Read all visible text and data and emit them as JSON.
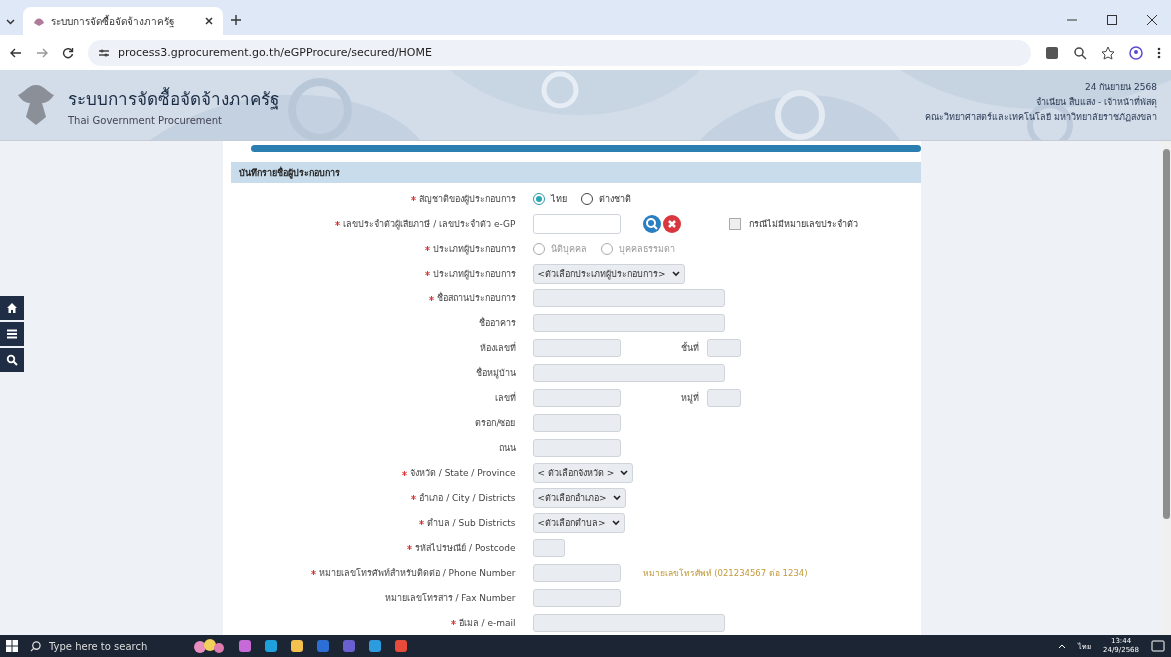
{
  "browser": {
    "tab_title": "ระบบการจัดซื้อจัดจ้างภาครัฐ",
    "url": "process3.gprocurement.go.th/eGPProcure/secured/HOME"
  },
  "header": {
    "title": "ระบบการจัดซื้อจัดจ้างภาครัฐ",
    "subtitle": "Thai Government Procurement",
    "date": "24 กันยายน 2568",
    "user": "จำเนียน สืบแสง - เจ้าหน้าที่พัสดุ",
    "organization": "คณะวิทยาศาสตร์และเทคโนโลยี มหาวิทยาลัยราชภัฏสงขลา"
  },
  "form": {
    "title": "บันทึกรายชื่อผู้ประกอบการ",
    "rows": [
      {
        "kind": "radio",
        "label": "สัญชาติของผู้ประกอบการ",
        "required": true,
        "disabled": false,
        "options": [
          {
            "label": "ไทย",
            "selected": true
          },
          {
            "label": "ต่างชาติ",
            "selected": false
          }
        ]
      },
      {
        "kind": "lookup",
        "label": "เลขประจำตัวผู้เสียภาษี / เลขประจำตัว e-GP",
        "required": true,
        "checkbox": {
          "label": "กรณีไม่มีหมายเลขประจำตัว",
          "checked": false
        }
      },
      {
        "kind": "radio",
        "label": "ประเภทผู้ประกอบการ",
        "required": true,
        "disabled": true,
        "options": [
          {
            "label": "นิติบุคคล",
            "selected": false
          },
          {
            "label": "บุคคลธรรมดา",
            "selected": false
          }
        ]
      },
      {
        "kind": "select",
        "label": "ประเภทผู้ประกอบการ",
        "required": true,
        "value": "<ตัวเลือกประเภทผู้ประกอบการ>"
      },
      {
        "kind": "wide",
        "label": "ชื่อสถานประกอบการ",
        "required": true
      },
      {
        "kind": "wide",
        "label": "ชื่ออาคาร",
        "required": false
      },
      {
        "kind": "pair",
        "label": "ห้องเลขที่",
        "required": false,
        "second_label": "ชั้นที่"
      },
      {
        "kind": "wide",
        "label": "ชื่อหมู่บ้าน",
        "required": false
      },
      {
        "kind": "pair",
        "label": "เลขที่",
        "required": false,
        "second_label": "หมู่ที่"
      },
      {
        "kind": "text",
        "label": "ตรอก/ซอย",
        "required": false
      },
      {
        "kind": "text",
        "label": "ถนน",
        "required": false
      },
      {
        "kind": "select",
        "label": "จังหวัด / State / Province",
        "required": true,
        "value": "< ตัวเลือกจังหวัด >"
      },
      {
        "kind": "select",
        "label": "อำเภอ / City / Districts",
        "required": true,
        "value": "<ตัวเลือกอำเภอ>"
      },
      {
        "kind": "select",
        "label": "ตำบล / Sub Districts",
        "required": true,
        "value": "<ตัวเลือกตำบล>"
      },
      {
        "kind": "short",
        "label": "รหัสไปรษณีย์ / Postcode",
        "required": true
      },
      {
        "kind": "text",
        "label": "หมายเลขโทรศัพท์สำหรับติดต่อ / Phone Number",
        "required": true,
        "hint": "หมายเลขโทรศัพท์ (021234567 ต่อ 1234)"
      },
      {
        "kind": "text",
        "label": "หมายเลขโทรสาร / Fax Number",
        "required": false
      },
      {
        "kind": "wide",
        "label": "อีเมล / e-mail",
        "required": true
      }
    ]
  },
  "taskbar": {
    "search_placeholder": "Type here to search",
    "language": "ไทย",
    "time": "13:44",
    "date": "24/9/2568"
  }
}
